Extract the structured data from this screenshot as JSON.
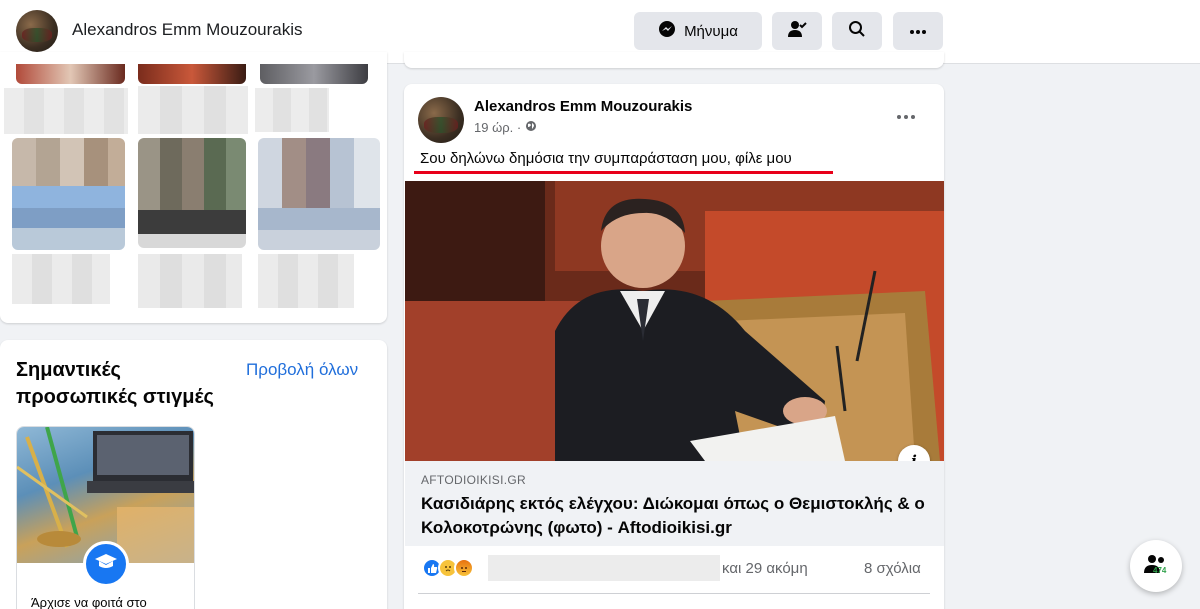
{
  "header": {
    "profile_name": "Alexandros Emm Mouzourakis",
    "message_button": "Μήνυμα"
  },
  "highlights": {
    "title": "Σημαντικές προσωπικές στιγμές",
    "view_all": "Προβολή όλων",
    "item_caption": "Άρχισε να φοιτά στο"
  },
  "post": {
    "author": "Alexandros Emm Mouzourakis",
    "time": "19 ώρ. ·",
    "text": "Σου δηλώνω δημόσια την συμπαράσταση μου, φίλε μου",
    "link_domain": "AFTODIOIKISI.GR",
    "link_title": "Κασιδιάρης εκτός ελέγχου: Διώκομαι όπως ο Θεμιστοκλής & ο Κολοκοτρώνης (φωτο) - Aftodioikisi.gr",
    "reactions_more": "και 29 ακόμη",
    "comments": "8 σχόλια"
  },
  "contacts": {
    "count": "474"
  },
  "colors": {
    "accent": "#1877f2",
    "link": "#216fdb",
    "underline": "#e8001a",
    "online": "#31a24c"
  }
}
